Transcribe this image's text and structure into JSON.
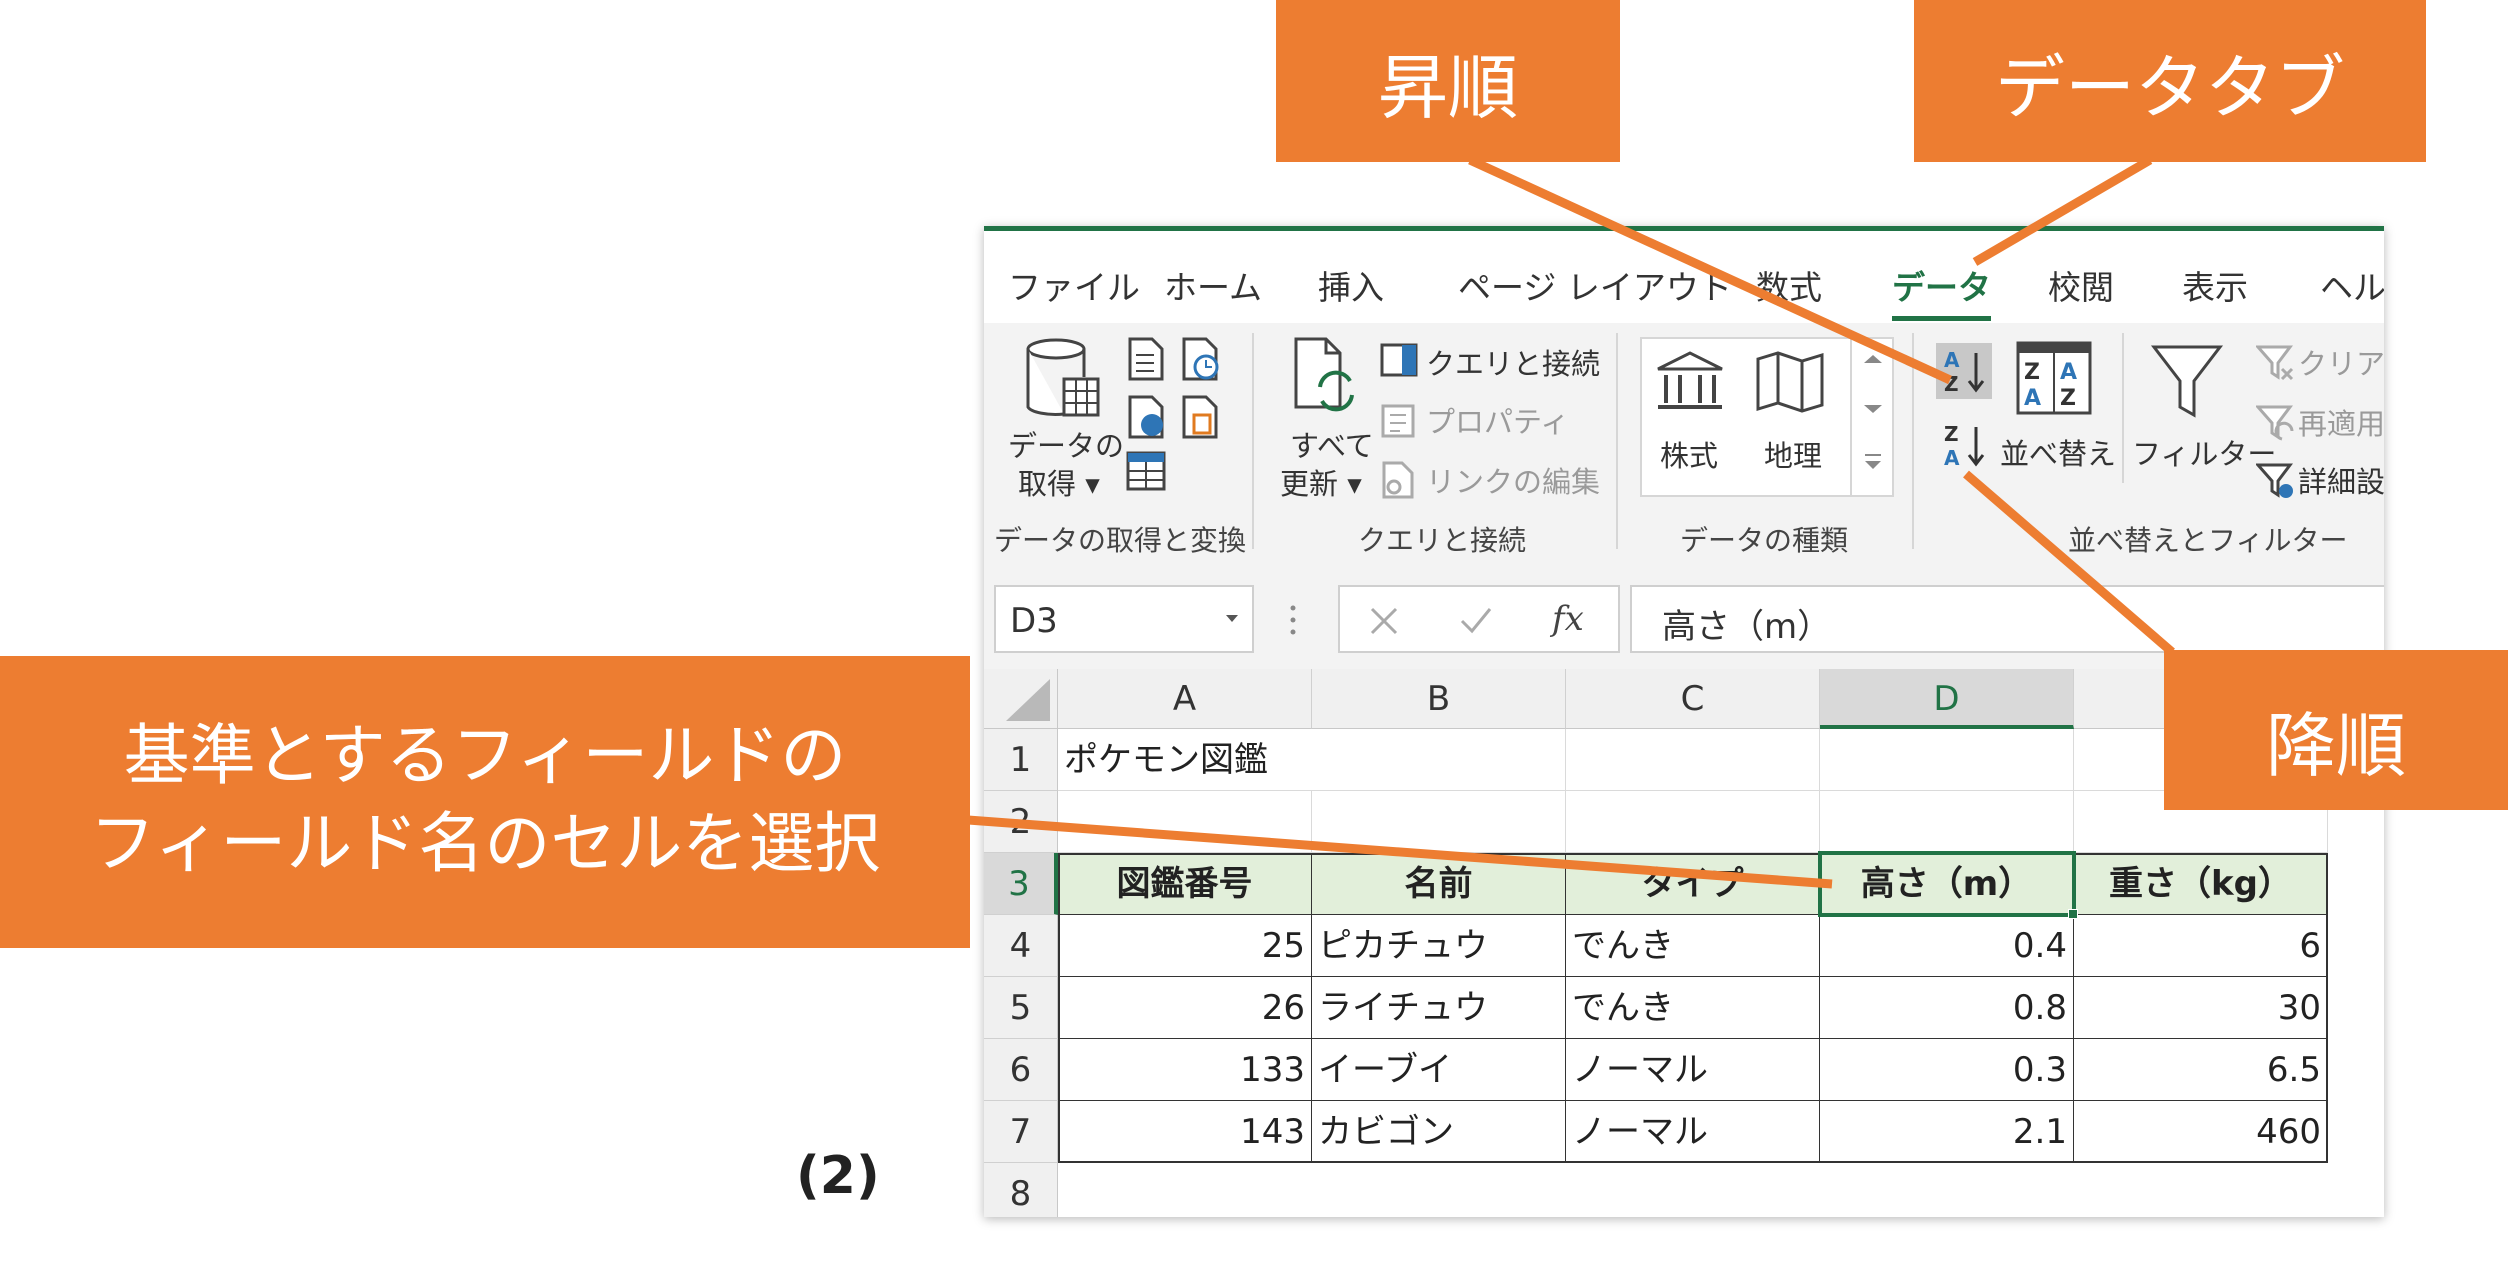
{
  "callouts": {
    "ascending": "昇順",
    "data_tab": "データタブ",
    "descending": "降順",
    "select_line1": "基準とするフィールドの",
    "select_line2": "フィールド名のセルを選択",
    "step": "(2)"
  },
  "accent_color": "#ed7d31",
  "excel_green": "#217346",
  "tabs": [
    "ファイル",
    "ホーム",
    "挿入",
    "ページ レイアウト",
    "数式",
    "データ",
    "校閲",
    "表示",
    "ヘルプ"
  ],
  "active_tab": "データ",
  "ribbon": {
    "get_data_label1": "データの",
    "get_data_label2": "取得 ▾",
    "group_get_transform": "データの取得と変換",
    "refresh_label1": "すべて",
    "refresh_label2": "更新 ▾",
    "queries_connections": "クエリと接続",
    "properties": "プロパティ",
    "edit_links": "リンクの編集",
    "group_queries": "クエリと接続",
    "stocks": "株式",
    "geography": "地理",
    "group_data_types": "データの種類",
    "sort": "並べ替え",
    "filter": "フィルター",
    "clear": "クリア",
    "reapply": "再適用",
    "advanced": "詳細設定",
    "group_sort_filter": "並べ替えとフィルター"
  },
  "formula_bar": {
    "name_box": "D3",
    "formula": "高さ（m）"
  },
  "sheet": {
    "columns": [
      "A",
      "B",
      "C",
      "D"
    ],
    "row_numbers": [
      "1",
      "2",
      "3",
      "4",
      "5",
      "6",
      "7",
      "8"
    ],
    "title": "ポケモン図鑑",
    "headers": [
      "図鑑番号",
      "名前",
      "タイプ",
      "高さ（m）",
      "重さ（kg）"
    ],
    "rows": [
      [
        "25",
        "ピカチュウ",
        "でんき",
        "0.4",
        "6"
      ],
      [
        "26",
        "ライチュウ",
        "でんき",
        "0.8",
        "30"
      ],
      [
        "133",
        "イーブイ",
        "ノーマル",
        "0.3",
        "6.5"
      ],
      [
        "143",
        "カビゴン",
        "ノーマル",
        "2.1",
        "460"
      ]
    ]
  }
}
